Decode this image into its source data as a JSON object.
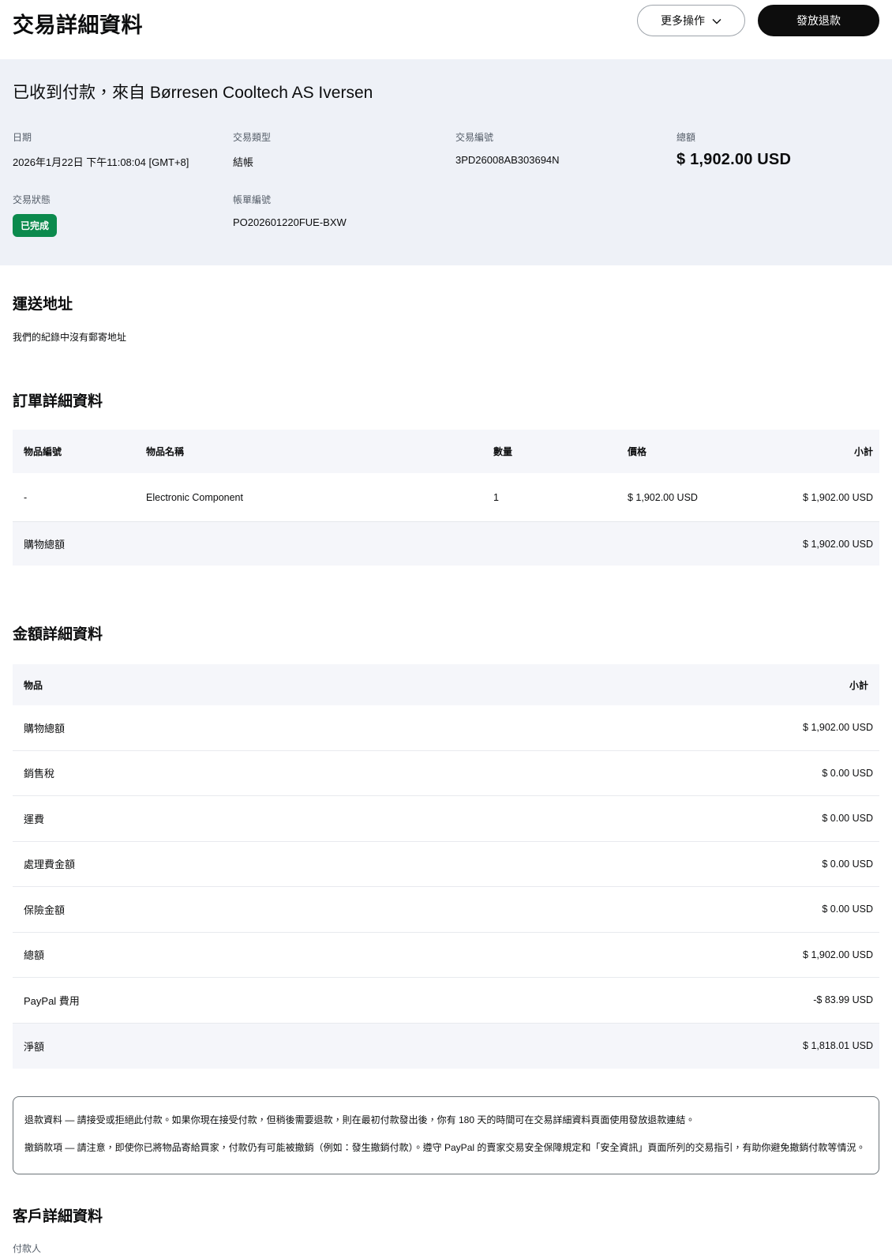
{
  "header": {
    "title": "交易詳細資料",
    "more_actions_label": "更多操作",
    "refund_button_label": "發放退款"
  },
  "summary": {
    "headline": "已收到付款，來自 Børresen Cooltech AS Iversen",
    "fields": [
      {
        "label": "日期",
        "value": "2026年1月22日 下午11:08:04 [GMT+8]"
      },
      {
        "label": "交易類型",
        "value": "結帳"
      },
      {
        "label": "交易編號",
        "value": "3PD26008AB303694N"
      },
      {
        "label": "總額",
        "value": "$ 1,902.00 USD"
      }
    ],
    "status_label": "交易狀態",
    "status_value": "已完成",
    "invoice_label": "帳單編號",
    "invoice_value": "PO202601220FUE-BXW"
  },
  "shipping": {
    "title": "運送地址",
    "body": "我們的紀錄中沒有郵寄地址"
  },
  "order": {
    "title": "訂單詳細資料",
    "columns": [
      "物品編號",
      "物品名稱",
      "數量",
      "價格",
      "小計"
    ],
    "rows": [
      [
        "-",
        "Electronic Component",
        "1",
        "$ 1,902.00 USD",
        "$ 1,902.00 USD"
      ]
    ],
    "footer_label": "購物總額",
    "footer_value": "$ 1,902.00 USD"
  },
  "amounts": {
    "title": "金額詳細資料",
    "columns": [
      "物品",
      "小計"
    ],
    "rows": [
      {
        "label": "購物總額",
        "value": "$ 1,902.00 USD"
      },
      {
        "label": "銷售稅",
        "value": "$ 0.00 USD"
      },
      {
        "label": "運費",
        "value": "$ 0.00 USD"
      },
      {
        "label": "處理費金額",
        "value": "$ 0.00 USD"
      },
      {
        "label": "保險金額",
        "value": "$ 0.00 USD"
      },
      {
        "label": "總額",
        "value": "$ 1,902.00 USD"
      },
      {
        "label": "PayPal 費用",
        "value": "-$ 83.99 USD"
      },
      {
        "label": "淨額",
        "value": "$ 1,818.01 USD"
      }
    ]
  },
  "notices": {
    "refund_info": "退款資料 — 請接受或拒絕此付款。如果你現在接受付款，但稍後需要退款，則在最初付款發出後，你有 180 天的時間可在交易詳細資料頁面使用發放退款連結。",
    "reversal_info": "撤銷款項 — 請注意，即使你已將物品寄給買家，付款仍有可能被撤銷（例如：發生撤銷付款）。遵守 PayPal 的賣家交易安全保障規定和「安全資訊」頁面所列的交易指引，有助你避免撤銷付款等情況。"
  },
  "customer": {
    "title": "客戶詳細資料",
    "payer_label": "付款人"
  },
  "colors": {
    "status_green": "#0b8a4d",
    "panel_bg": "#eef1f7",
    "table_header_bg": "#f5f6fa"
  }
}
